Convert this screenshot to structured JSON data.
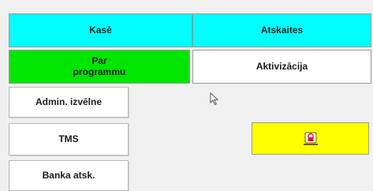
{
  "top_tabs": {
    "kase": "Kasē",
    "atskaites": "Atskaites"
  },
  "second_row": {
    "par_line1": "Par",
    "par_line2": "programmu",
    "aktivizacija": "Aktivizācija"
  },
  "left_menu": {
    "admin": "Admin. izvēlne",
    "tms": "TMS",
    "banka": "Banka atsk."
  },
  "lock_button": {
    "icon": "lock-icon"
  },
  "colors": {
    "cyan": "#00ffff",
    "green": "#00e600",
    "yellow": "#ffff00",
    "lock_red": "#e0102a"
  }
}
